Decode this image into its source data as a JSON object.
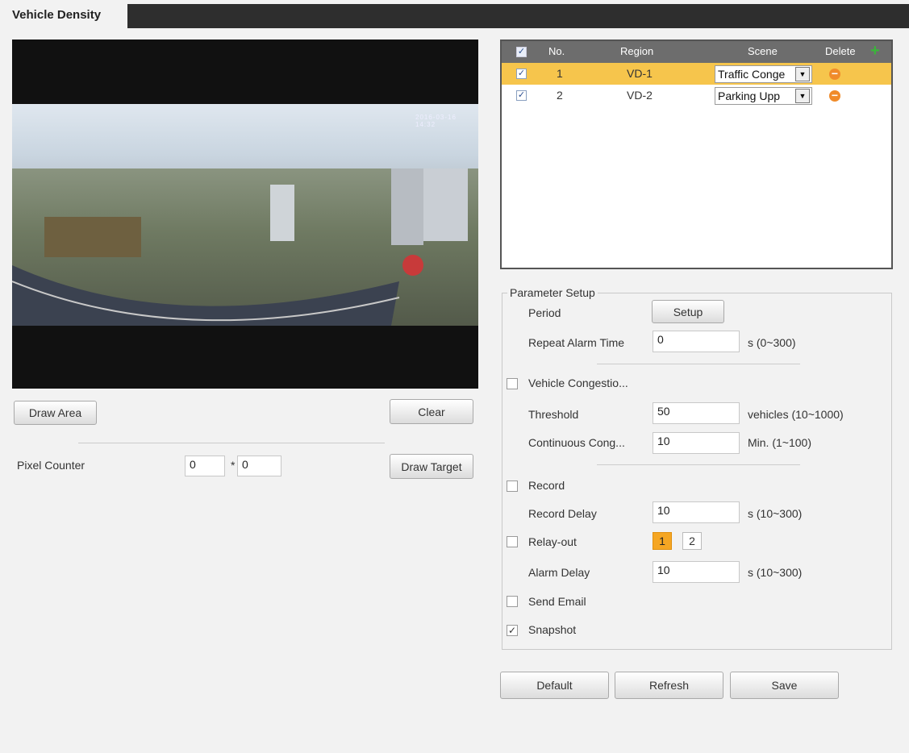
{
  "header": {
    "tab_label": "Vehicle Density"
  },
  "video": {
    "osd_text": "2016-03-16 14:32"
  },
  "left_controls": {
    "draw_area_label": "Draw Area",
    "clear_label": "Clear",
    "pixel_counter_label": "Pixel Counter",
    "pixel_width": "0",
    "pixel_sep": "*",
    "pixel_height": "0",
    "draw_target_label": "Draw Target"
  },
  "region_table": {
    "headers": {
      "no": "No.",
      "region": "Region",
      "scene": "Scene",
      "delete": "Delete"
    },
    "rows": [
      {
        "no": "1",
        "region": "VD-1",
        "scene": "Traffic Conge",
        "checked": true,
        "highlight": "#f6c54c"
      },
      {
        "no": "2",
        "region": "VD-2",
        "scene": "Parking Upp",
        "checked": true
      }
    ]
  },
  "parameter_setup": {
    "legend": "Parameter Setup",
    "period_label": "Period",
    "setup_button": "Setup",
    "repeat_alarm_label": "Repeat Alarm Time",
    "repeat_alarm_value": "0",
    "repeat_alarm_unit": "s (0~300)",
    "vehicle_congestion_label": "Vehicle Congestio...",
    "threshold_label": "Threshold",
    "threshold_value": "50",
    "threshold_unit": "vehicles (10~1000)",
    "continuous_label": "Continuous Cong...",
    "continuous_value": "10",
    "continuous_unit": "Min. (1~100)",
    "record_label": "Record",
    "record_delay_label": "Record Delay",
    "record_delay_value": "10",
    "record_delay_unit": "s (10~300)",
    "relay_out_label": "Relay-out",
    "relay_1": "1",
    "relay_2": "2",
    "alarm_delay_label": "Alarm Delay",
    "alarm_delay_value": "10",
    "alarm_delay_unit": "s (10~300)",
    "send_email_label": "Send Email",
    "snapshot_label": "Snapshot",
    "snapshot_checked": "✓"
  },
  "footer": {
    "default_label": "Default",
    "refresh_label": "Refresh",
    "save_label": "Save"
  },
  "colors": {
    "highlight": "#f6c54c",
    "relay_active": "#f5a623",
    "delete_icon": "#f08b2a",
    "add_icon": "#3ab53a"
  }
}
